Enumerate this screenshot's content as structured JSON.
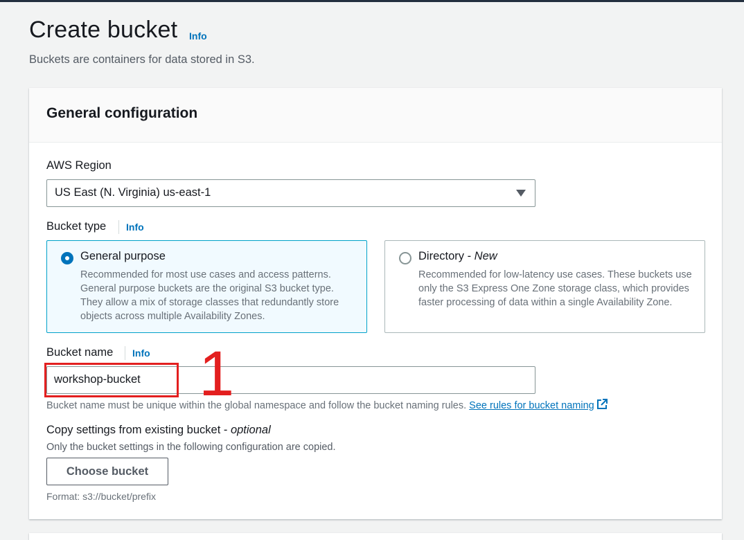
{
  "page": {
    "title": "Create bucket",
    "title_info": "Info",
    "subtitle": "Buckets are containers for data stored in S3."
  },
  "general_config": {
    "title": "General configuration",
    "region": {
      "label": "AWS Region",
      "value": "US East (N. Virginia) us-east-1"
    },
    "bucket_type": {
      "label": "Bucket type",
      "info": "Info",
      "options": [
        {
          "title": "General purpose",
          "tag": "",
          "selected": true,
          "description": "Recommended for most use cases and access patterns. General purpose buckets are the original S3 bucket type. They allow a mix of storage classes that redundantly store objects across multiple Availability Zones."
        },
        {
          "title": "Directory - ",
          "tag": "New",
          "selected": false,
          "description": "Recommended for low-latency use cases. These buckets use only the S3 Express One Zone storage class, which provides faster processing of data within a single Availability Zone."
        }
      ]
    },
    "bucket_name": {
      "label": "Bucket name",
      "info": "Info",
      "value": "workshop-bucket",
      "hint": "Bucket name must be unique within the global namespace and follow the bucket naming rules. ",
      "hint_link": "See rules for bucket naming"
    },
    "copy_settings": {
      "label": "Copy settings from existing bucket - ",
      "optional": "optional",
      "description": "Only the bucket settings in the following configuration are copied.",
      "button": "Choose bucket",
      "format": "Format: s3://bucket/prefix"
    }
  },
  "annotation": {
    "number": "1",
    "color": "#e31f1f"
  },
  "colors": {
    "link": "#0073bb",
    "selected_border": "#00a1c9",
    "selected_bg": "#f1faff"
  }
}
